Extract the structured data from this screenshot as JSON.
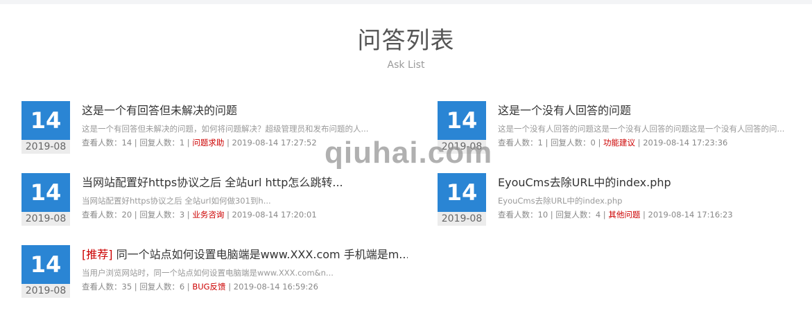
{
  "header": {
    "title": "问答列表",
    "subtitle": "Ask List"
  },
  "watermark": "qiuhai.com",
  "questions": [
    {
      "day": "14",
      "year_month": "2019-08",
      "tag": "",
      "title": "这是一个有回答但未解决的问题",
      "desc": "这是一个有回答但未解决的问题，如何将问题解决？超级管理员和发布问题的人...",
      "views_label": "查看人数：14",
      "replies_label": "回复人数：1",
      "category": "问题求助",
      "time": "2019-08-14 17:27:52"
    },
    {
      "day": "14",
      "year_month": "2019-08",
      "tag": "",
      "title": "这是一个没有人回答的问题",
      "desc": "这是一个没有人回答的问题这是一个没有人回答的问题这是一个没有人回答的问...",
      "views_label": "查看人数：1",
      "replies_label": "回复人数：0",
      "category": "功能建议",
      "time": "2019-08-14 17:23:36"
    },
    {
      "day": "14",
      "year_month": "2019-08",
      "tag": "",
      "title": "当网站配置好https协议之后 全站url http怎么跳转...",
      "desc": "当网站配置好https协议之后  全站url如何做301到h...",
      "views_label": "查看人数：20",
      "replies_label": "回复人数：3",
      "category": "业务咨询",
      "time": "2019-08-14 17:20:01"
    },
    {
      "day": "14",
      "year_month": "2019-08",
      "tag": "",
      "title": "EyouCms去除URL中的index.php",
      "desc": "EyouCms去除URL中的index.php",
      "views_label": "查看人数：10",
      "replies_label": "回复人数：4",
      "category": "其他问题",
      "time": "2019-08-14 17:16:23"
    },
    {
      "day": "14",
      "year_month": "2019-08",
      "tag": "[推荐]",
      "title": "同一个站点如何设置电脑端是www.XXX.com 手机端是m...",
      "desc": "当用户浏览网站时，同一个站点如何设置电脑端是www.XXX.com&n...",
      "views_label": "查看人数：35",
      "replies_label": "回复人数：6",
      "category": "BUG反馈",
      "time": "2019-08-14 16:59:26"
    }
  ],
  "colors": {
    "date_blue": "#2a85d4",
    "category_red": "#cc0000"
  }
}
